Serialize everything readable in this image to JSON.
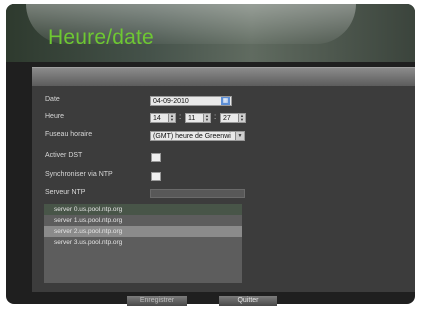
{
  "header": {
    "title": "Heure/date"
  },
  "form": {
    "date": {
      "label": "Date",
      "value": "04-09-2010"
    },
    "time": {
      "label": "Heure",
      "hour": "14",
      "minute": "11",
      "second": "27"
    },
    "timezone": {
      "label": "Fuseau horaire",
      "value": "(GMT) heure de Greenwi"
    },
    "dst": {
      "label": "Activer DST"
    },
    "ntp_sync": {
      "label": "Synchroniser via NTP"
    },
    "ntp_server": {
      "label": "Serveur NTP"
    }
  },
  "ntp_servers": [
    "server 0.us.pool.ntp.org",
    "server 1.us.pool.ntp.org",
    "server 2.us.pool.ntp.org",
    "server 3.us.pool.ntp.org"
  ],
  "buttons": {
    "save": "Enregistrer",
    "exit": "Quitter"
  },
  "icons": {
    "calendar": "calendar-icon",
    "spin_up": "chevron-up-icon",
    "spin_down": "chevron-down-icon",
    "dropdown": "chevron-down-icon"
  }
}
